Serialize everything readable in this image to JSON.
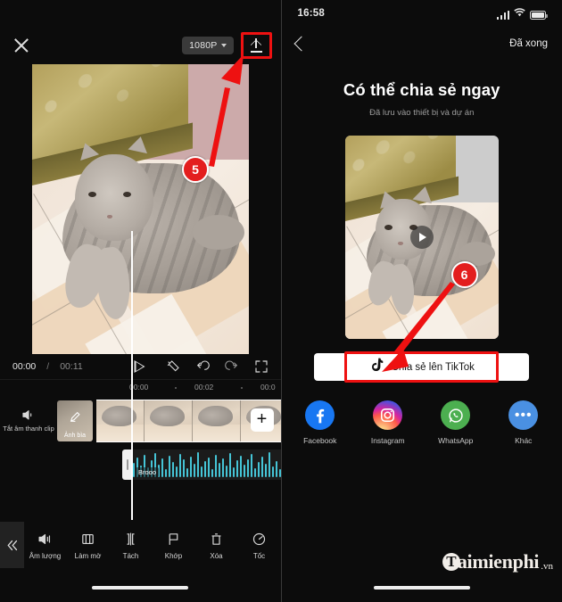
{
  "left": {
    "topbar": {
      "close_icon": "close-icon",
      "resolution": "1080P",
      "export_icon": "export-upload-icon"
    },
    "controls": {
      "current_time": "00:00",
      "separator": "/",
      "total_time": "00:11",
      "play_icon": "play-icon",
      "magic_icon": "magic-wand-icon",
      "undo_icon": "undo-icon",
      "redo_icon": "redo-icon",
      "fullscreen_icon": "fullscreen-icon"
    },
    "timeline": {
      "ruler_labels": [
        "00:00",
        "00:02",
        "00:0"
      ],
      "mute_label": "Tắt âm thanh clip",
      "cover_label": "Ảnh bìa",
      "add_label": "+",
      "audio_clip_name": "Brooo"
    },
    "toolbar": {
      "collapse_icon": "collapse-chevrons-icon",
      "items": [
        {
          "label": "Âm lượng",
          "icon": "volume-icon"
        },
        {
          "label": "Làm mờ",
          "icon": "blur-icon"
        },
        {
          "label": "Tách",
          "icon": "split-icon"
        },
        {
          "label": "Khớp",
          "icon": "flag-icon"
        },
        {
          "label": "Xóa",
          "icon": "trash-icon"
        },
        {
          "label": "Tốc",
          "icon": "speed-icon"
        }
      ]
    },
    "callout": {
      "step": "5"
    }
  },
  "right": {
    "statusbar": {
      "time": "16:58",
      "signal_icon": "cellular-signal-icon",
      "wifi_icon": "wifi-icon",
      "battery_icon": "battery-icon"
    },
    "topbar": {
      "back_icon": "chevron-left-icon",
      "done_label": "Đã xong"
    },
    "title": "Có thể chia sẻ ngay",
    "subtitle": "Đã lưu vào thiết bị và dự án",
    "preview": {
      "play_icon": "play-icon"
    },
    "tiktok_button": {
      "label": "Chia sẻ lên TikTok",
      "icon": "tiktok-icon"
    },
    "socials": [
      {
        "label": "Facebook",
        "icon": "facebook-icon",
        "color": "#1877f2",
        "glyph": "f"
      },
      {
        "label": "Instagram",
        "icon": "instagram-icon",
        "color": "#d6249f",
        "glyph": ""
      },
      {
        "label": "WhatsApp",
        "icon": "whatsapp-icon",
        "color": "#4caf50",
        "glyph": ""
      },
      {
        "label": "Khác",
        "icon": "more-dots-icon",
        "color": "#4a90e2",
        "glyph": "•••"
      }
    ],
    "watermark": {
      "initial": "T",
      "name": "aimienphi",
      "tld": ".vn"
    },
    "callout": {
      "step": "6"
    }
  },
  "colors": {
    "accent_red": "#e31e1e",
    "background": "#0c0c0c",
    "waveform": "#45c4d6"
  }
}
